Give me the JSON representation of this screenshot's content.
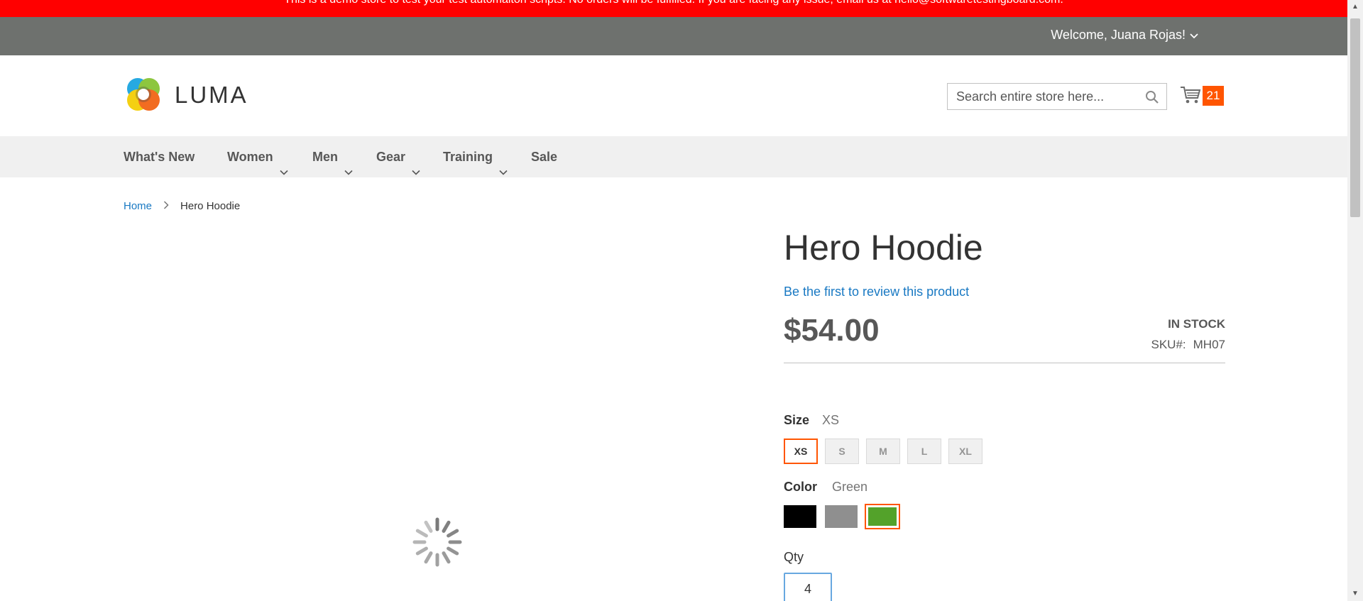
{
  "banner": {
    "text": "This is a demo store to test your test automaiton scripts. No orders will be fulfilled. If you are facing any issue, email us at hello@softwaretestingboard.com."
  },
  "top_bar": {
    "welcome": "Welcome, Juana Rojas!"
  },
  "header": {
    "logo_text": "LUMA",
    "search_placeholder": "Search entire store here...",
    "cart_count": "21"
  },
  "nav": {
    "items": [
      {
        "label": "What's New",
        "has_dropdown": false
      },
      {
        "label": "Women",
        "has_dropdown": true
      },
      {
        "label": "Men",
        "has_dropdown": true
      },
      {
        "label": "Gear",
        "has_dropdown": true
      },
      {
        "label": "Training",
        "has_dropdown": true
      },
      {
        "label": "Sale",
        "has_dropdown": false
      }
    ]
  },
  "breadcrumb": {
    "home": "Home",
    "current": "Hero Hoodie"
  },
  "product": {
    "title": "Hero Hoodie",
    "review_link": "Be the first to review this product",
    "price": "$54.00",
    "stock": "IN STOCK",
    "sku_label": "SKU#:",
    "sku_value": "MH07",
    "size_label": "Size",
    "size_selected": "XS",
    "sizes": [
      "XS",
      "S",
      "M",
      "L",
      "XL"
    ],
    "color_label": "Color",
    "color_selected": "Green",
    "colors": [
      {
        "name": "Black",
        "hex": "#000000"
      },
      {
        "name": "Gray",
        "hex": "#8f8f8f"
      },
      {
        "name": "Green",
        "hex": "#53a22a"
      }
    ],
    "qty_label": "Qty",
    "qty_value": "4"
  },
  "colors": {
    "banner": "#ff0000",
    "top_bar": "#6e716e",
    "accent": "#ff5501",
    "link": "#1979c3"
  }
}
